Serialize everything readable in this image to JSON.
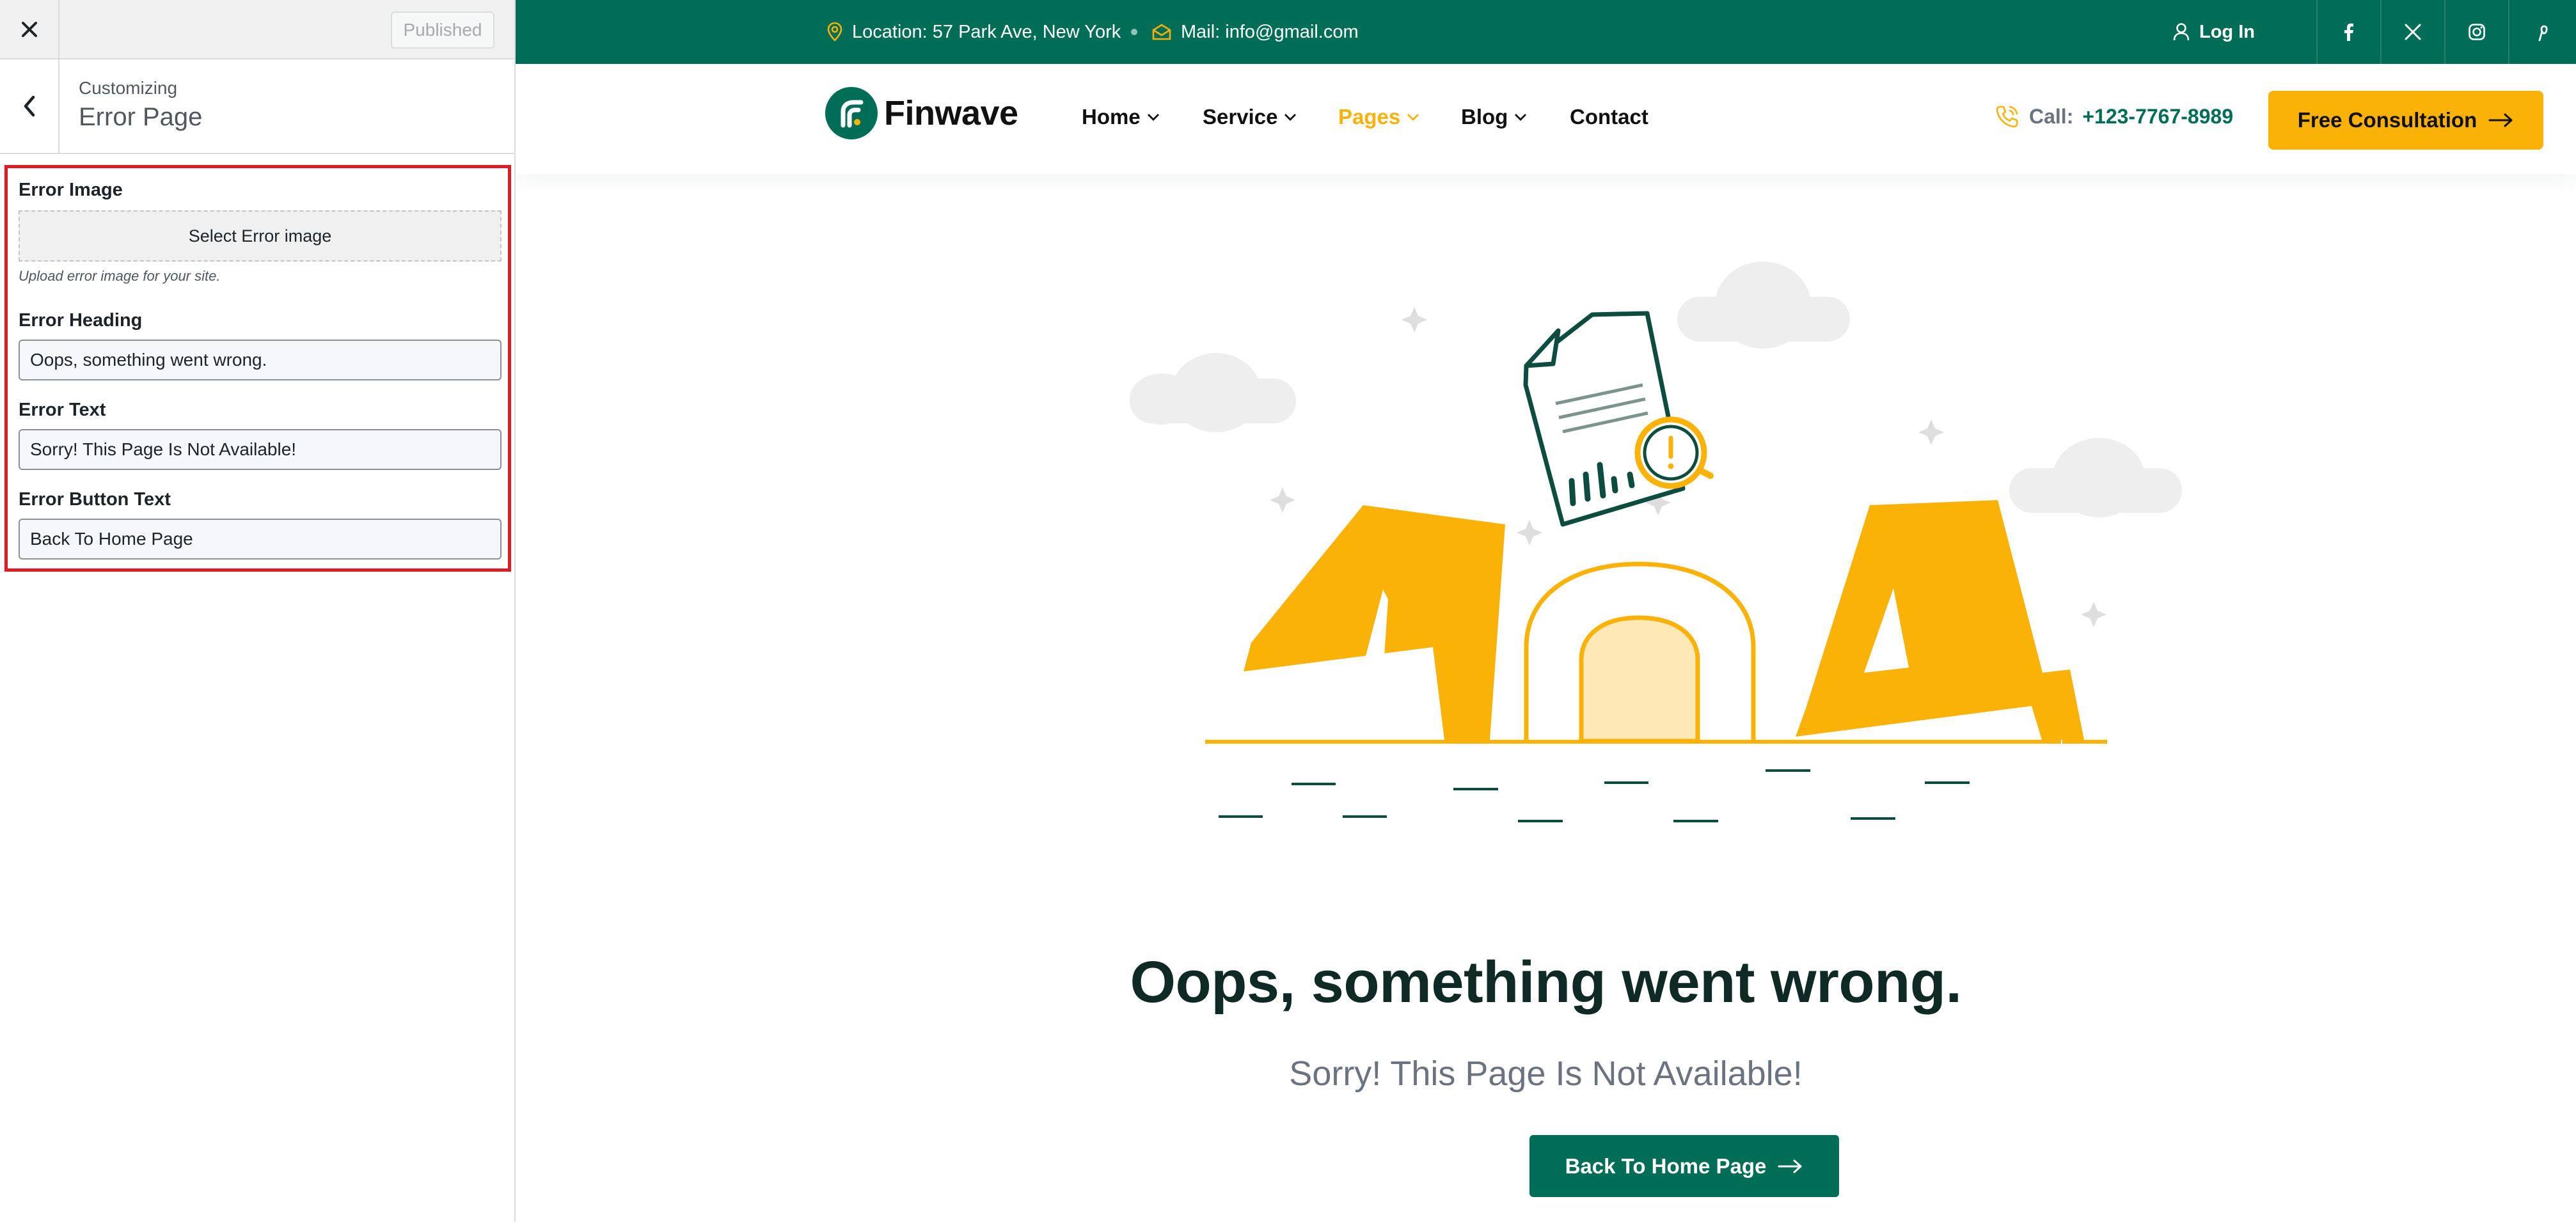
{
  "customizer": {
    "close_icon": "close-icon",
    "published_label": "Published",
    "back_icon": "chevron-left-icon",
    "breadcrumb": "Customizing",
    "section_title": "Error Page",
    "highlight_color": "#e01b24",
    "fields": {
      "image_label": "Error Image",
      "image_button": "Select Error image",
      "image_description": "Upload error image for your site.",
      "heading_label": "Error Heading",
      "heading_value": "Oops, something went wrong.",
      "text_label": "Error Text",
      "text_value": "Sorry! This Page Is Not Available!",
      "button_label": "Error Button Text",
      "button_value": "Back To Home Page"
    }
  },
  "site": {
    "colors": {
      "brand_green": "#006d57",
      "accent_yellow": "#fbb207",
      "heading": "#0f2a25"
    },
    "topbar": {
      "location": "Location: 57 Park Ave, New York",
      "mail": "Mail: info@gmail.com",
      "login": "Log In",
      "social_icons": [
        "facebook-icon",
        "x-twitter-icon",
        "instagram-icon",
        "pinterest-icon"
      ]
    },
    "header": {
      "logo_text": "Finwave",
      "nav": [
        {
          "label": "Home",
          "has_dropdown": true,
          "active": false
        },
        {
          "label": "Service",
          "has_dropdown": true,
          "active": false
        },
        {
          "label": "Pages",
          "has_dropdown": true,
          "active": true
        },
        {
          "label": "Blog",
          "has_dropdown": true,
          "active": false
        },
        {
          "label": "Contact",
          "has_dropdown": false,
          "active": false
        }
      ],
      "call_label": "Call:",
      "call_number": "+123-7767-8989",
      "cta": "Free Consultation"
    },
    "error": {
      "illustration": "404-illustration",
      "heading": "Oops, something went wrong.",
      "text": "Sorry! This Page Is Not Available!",
      "button": "Back To Home Page"
    }
  }
}
